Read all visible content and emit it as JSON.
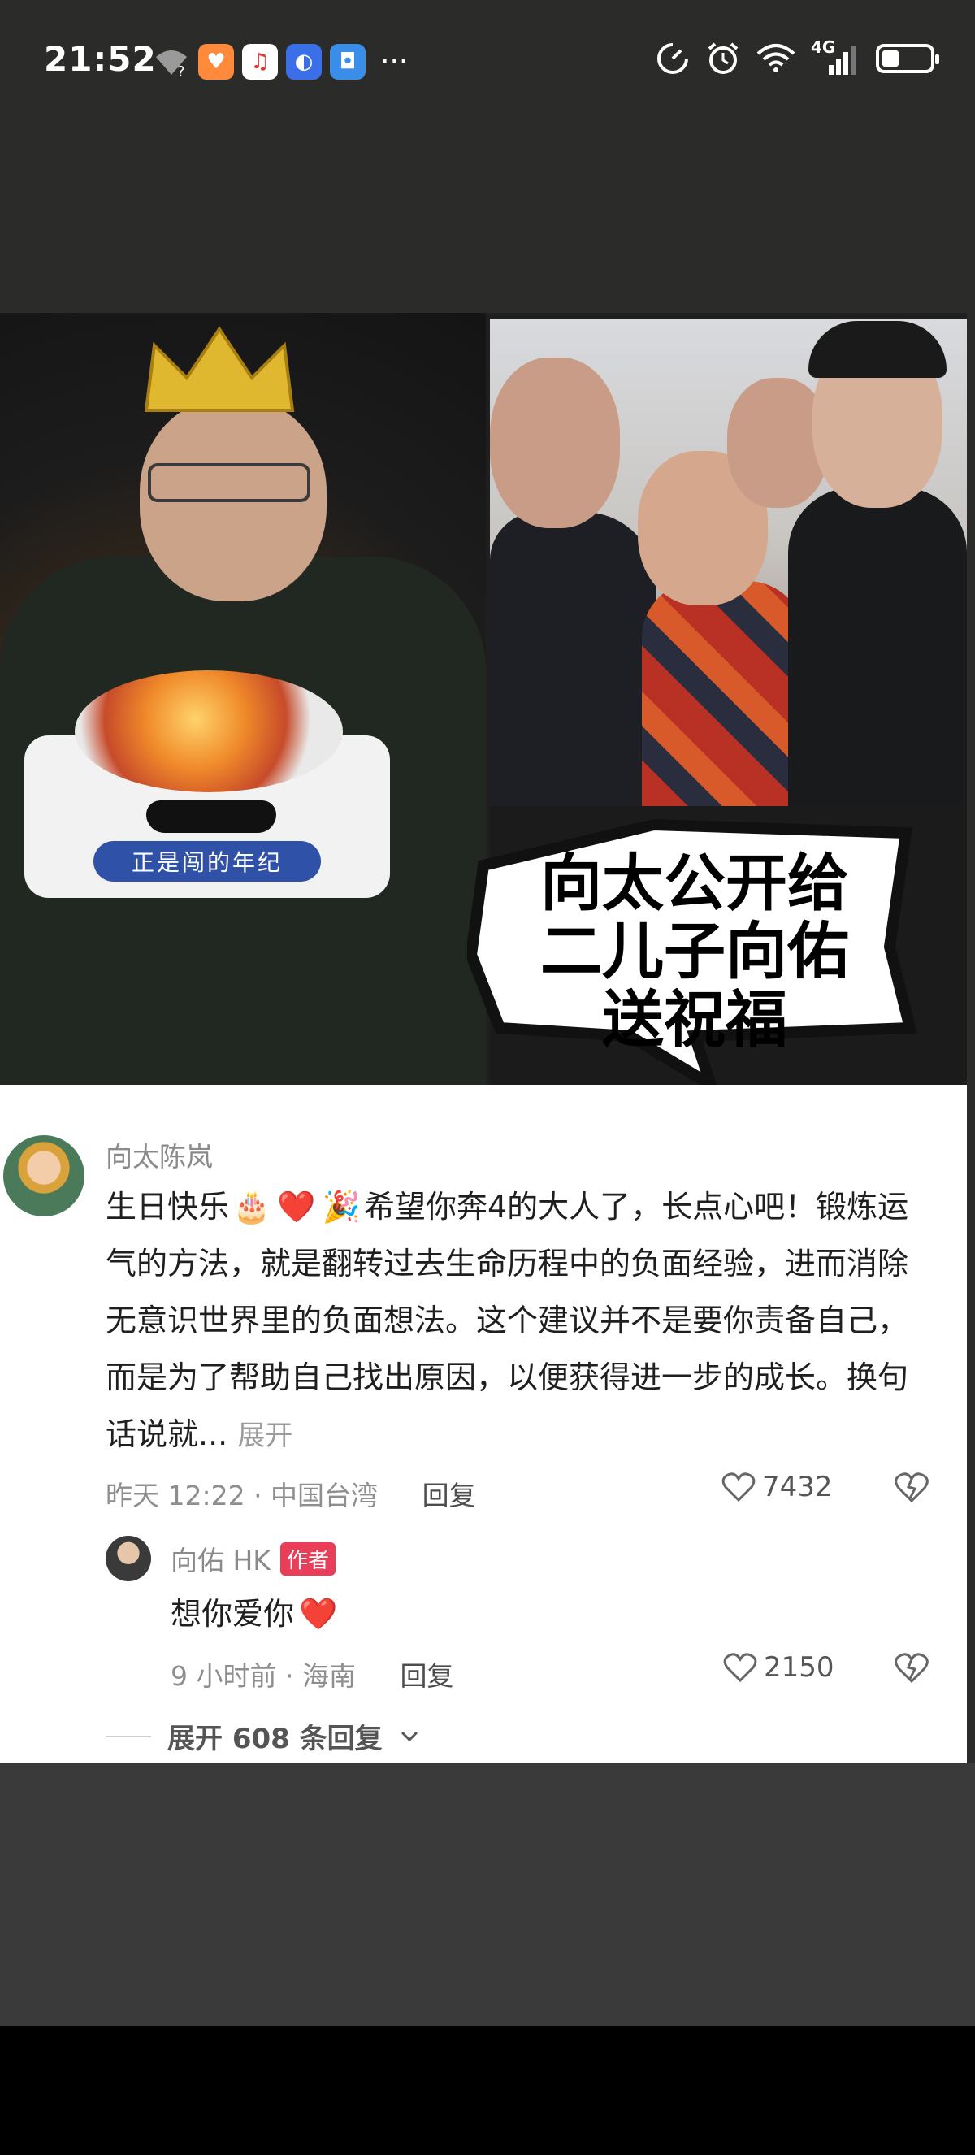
{
  "status_bar": {
    "time": "21:52",
    "network": "4G",
    "icons": [
      "wifi-question-icon",
      "heart-app-icon",
      "music-app-icon",
      "compass-app-icon",
      "shield-app-icon",
      "speed-icon",
      "alarm-icon",
      "wifi-icon",
      "signal-icon",
      "battery-icon"
    ],
    "more": "···"
  },
  "image": {
    "cake_banner": "正是闯的年纪",
    "caption_lines": [
      "向太公开给",
      "二儿子向佑",
      "送祝福"
    ]
  },
  "comment": {
    "author": "向太陈岚",
    "text_prefix": "生日快乐",
    "emojis": [
      "🎂",
      "❤️",
      "🎉"
    ],
    "text_body": "希望你奔4的大人了，长点心吧！锻炼运气的方法，就是翻转过去生命历程中的负面经验，进而消除无意识世界里的负面想法。这个建议并不是要你责备自己，而是为了帮助自己找出原因，以便获得进一步的成长。换句话说就...",
    "expand_label": "展开",
    "meta": "昨天 12:22 · 中国台湾",
    "reply_label": "回复",
    "likes": "7432"
  },
  "reply": {
    "author": "向佑 HK",
    "badge": "作者",
    "text": "想你爱你",
    "emoji": "❤️",
    "meta": "9 小时前 · 海南",
    "reply_label": "回复",
    "likes": "2150"
  },
  "expand_replies": {
    "label": "展开 608 条回复"
  },
  "colors": {
    "badge": "#e83e5a",
    "heart": "#e8322e"
  }
}
